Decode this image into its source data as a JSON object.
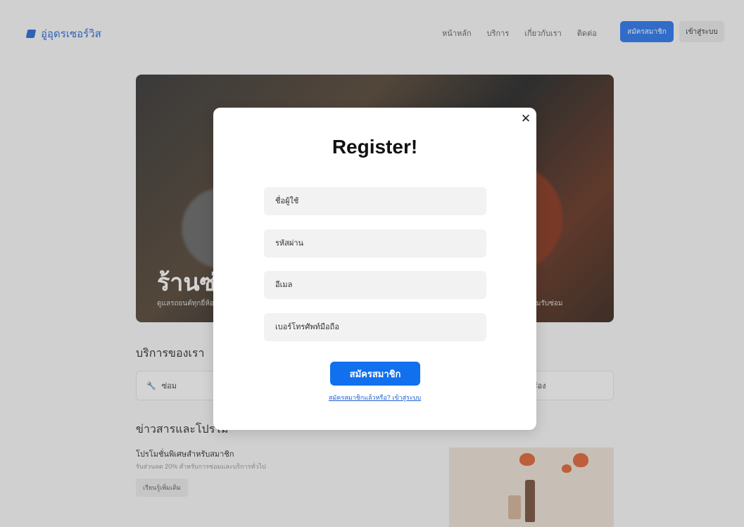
{
  "nav": {
    "brand": "อู่อุดรเซอร์วิส",
    "links": [
      "หน้าหลัก",
      "บริการ",
      "เกี่ยวกับเรา",
      "ติดต่อ"
    ],
    "signup_label": "สมัครสมาชิก",
    "login_label": "เข้าสู่ระบบ"
  },
  "hero": {
    "title": "ร้านซ่อ",
    "subtitle": "ดูแลรถยนต์ทุกยี่ห้อ",
    "subtitle_right": "ซ่อมรับซ่อม"
  },
  "services": {
    "title": "บริการของเรา",
    "card1_label": "ซ่อม",
    "card2_label": "เปลี่ยนเครื่อง"
  },
  "news": {
    "title": "ข่าวสารและโปรโม",
    "promo_title": "โปรโมชั่นพิเศษสำหรับสมาชิก",
    "promo_desc": "รับส่วนลด 20% สำหรับการซ่อมและบริการทั่วไป",
    "promo_button": "เรียนรู้เพิ่มเติม"
  },
  "modal": {
    "title": "Register!",
    "close_symbol": "✕",
    "username_placeholder": "ชื่อผู้ใช้",
    "password_placeholder": "รหัสผ่าน",
    "email_placeholder": "อีเมล",
    "phone_placeholder": "เบอร์โทรศัพท์มือถือ",
    "submit_label": "สมัครสมาชิก",
    "login_link": "สมัครสมาชิกแล้วหรือ? เข้าสู่ระบบ"
  },
  "colors": {
    "primary": "#1170ee",
    "brand": "#2c6fd6"
  }
}
